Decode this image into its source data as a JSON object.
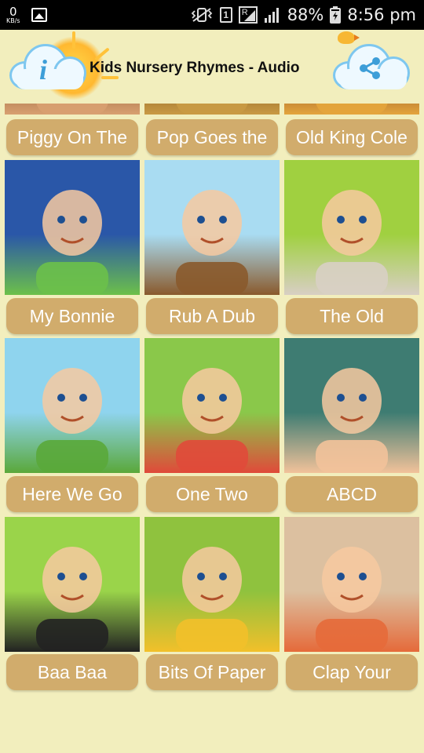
{
  "status_bar": {
    "speed_value": "0",
    "speed_unit": "KB/s",
    "sim_label": "1",
    "roaming_label": "R",
    "battery_percent": "88%",
    "time": "8:56 pm"
  },
  "header": {
    "title": "Kids Nursery Rhymes - Audio",
    "info_icon": "info-icon",
    "share_icon": "share-icon",
    "info_letter": "i"
  },
  "rhymes": [
    {
      "label": "Piggy On The",
      "thumb_colors": [
        "#6b3a1f",
        "#d8a070"
      ]
    },
    {
      "label": "Pop Goes the",
      "thumb_colors": [
        "#5a3410",
        "#c99a44"
      ]
    },
    {
      "label": "Old King Cole",
      "thumb_colors": [
        "#5a1d1d",
        "#e4a53c"
      ]
    },
    {
      "label": "My Bonnie",
      "thumb_colors": [
        "#2a57a8",
        "#6cc04a"
      ]
    },
    {
      "label": "Rub A Dub",
      "thumb_colors": [
        "#a9dcf2",
        "#8a5a2c"
      ]
    },
    {
      "label": "The Old",
      "thumb_colors": [
        "#a0d040",
        "#d8cfc4"
      ]
    },
    {
      "label": "Here We Go",
      "thumb_colors": [
        "#8fd4ee",
        "#5aa83a"
      ]
    },
    {
      "label": "One Two",
      "thumb_colors": [
        "#8ac84a",
        "#e04a3a"
      ]
    },
    {
      "label": "ABCD",
      "thumb_colors": [
        "#3e7c72",
        "#f2c29a"
      ]
    },
    {
      "label": "Baa Baa",
      "thumb_colors": [
        "#9ad44a",
        "#222222"
      ]
    },
    {
      "label": "Bits Of Paper",
      "thumb_colors": [
        "#8fc23e",
        "#f2c02a"
      ]
    },
    {
      "label": "Clap Your",
      "thumb_colors": [
        "#dcc0a0",
        "#e56a3a"
      ]
    }
  ],
  "colors": {
    "background": "#f2eebd",
    "button": "#d1ac6c",
    "button_text": "#ffffff"
  }
}
